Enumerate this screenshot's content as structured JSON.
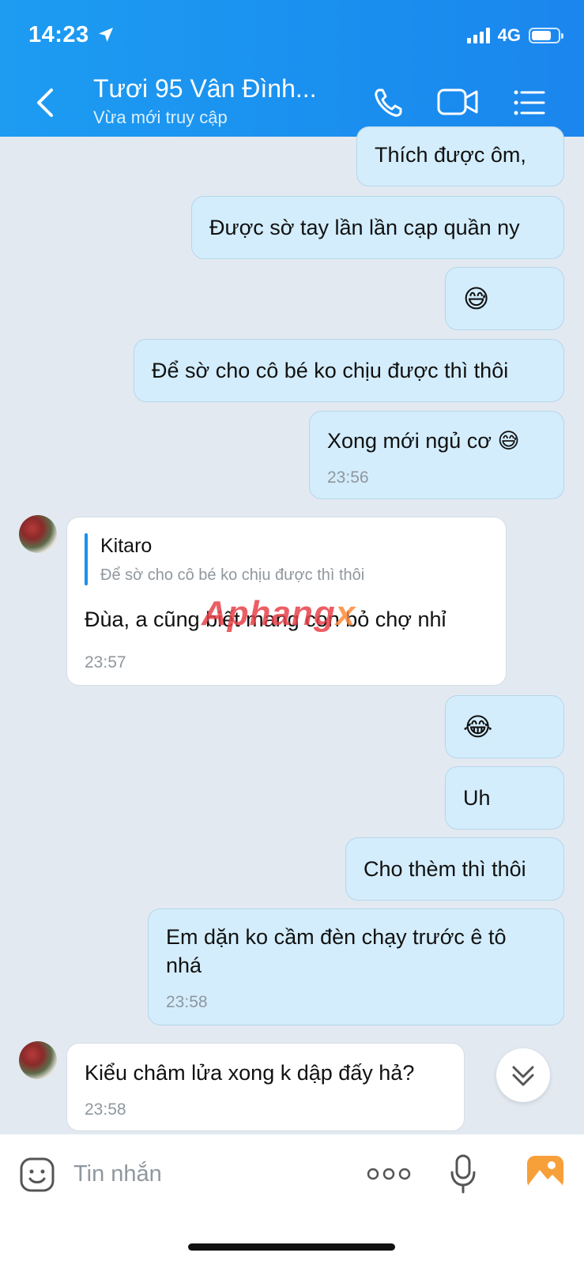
{
  "status": {
    "time": "14:23",
    "network": "4G"
  },
  "header": {
    "title": "Tươi 95 Vân Đình...",
    "subtitle": "Vừa mới truy cập"
  },
  "messages": [
    {
      "text": "Thích được ôm,"
    },
    {
      "text": "Được sờ tay lần lần cạp quần ny"
    },
    {
      "text": "😅"
    },
    {
      "text": "Để sờ cho cô bé ko chịu được thì thôi"
    },
    {
      "text": "Xong mới ngủ cơ 😅",
      "time": "23:56"
    },
    {
      "quote_name": "Kitaro",
      "quote_text": "Để sờ cho cô bé ko chịu được thì thôi",
      "text": "Đùa, a cũng biết mang con bỏ chợ nhỉ",
      "time": "23:57"
    },
    {
      "text": "😂"
    },
    {
      "text": "Uh"
    },
    {
      "text": "Cho thèm thì thôi"
    },
    {
      "text_line1": "Em dặn ko cầm đèn chạy trước ê tô",
      "text_line2": "nhá",
      "time": "23:58"
    },
    {
      "text": "Kiểu châm lửa xong k dập đấy hả?",
      "time": "23:58"
    }
  ],
  "watermark": {
    "part1": "Aphang",
    "part2": "x"
  },
  "composer": {
    "placeholder": "Tin nhắn"
  },
  "colors": {
    "header": "#1a8fef",
    "my_bubble": "#d3edfc",
    "their_bubble": "#ffffff",
    "background": "#e2e9f1"
  }
}
